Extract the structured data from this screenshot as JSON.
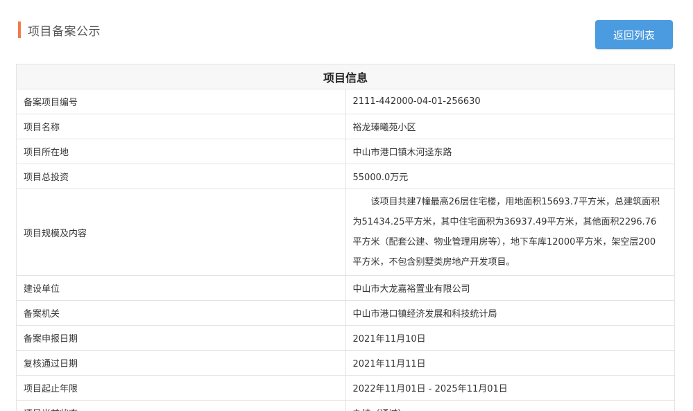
{
  "header": {
    "title": "项目备案公示",
    "accent_color": "#f37a4a"
  },
  "actions": {
    "back_label": "返回列表",
    "back_color": "#4a9be0"
  },
  "table": {
    "caption": "项目信息",
    "rows": [
      {
        "label": "备案项目编号",
        "value": "2111-442000-04-01-256630"
      },
      {
        "label": "项目名称",
        "value": "裕龙瑧曦苑小区"
      },
      {
        "label": "项目所在地",
        "value": "中山市港口镇木河迳东路"
      },
      {
        "label": "项目总投资",
        "value": "55000.0万元"
      },
      {
        "label": "项目规模及内容",
        "value": "该项目共建7幢最高26层住宅楼，用地面积15693.7平方米，总建筑面积为51434.25平方米，其中住宅面积为36937.49平方米，其他面积2296.76平方米（配套公建、物业管理用房等），地下车库12000平方米，架空层200平方米，不包含别墅类房地产开发项目。"
      },
      {
        "label": "建设单位",
        "value": "中山市大龙嘉裕置业有限公司"
      },
      {
        "label": "备案机关",
        "value": "中山市港口镇经济发展和科技统计局"
      },
      {
        "label": "备案申报日期",
        "value": "2021年11月10日"
      },
      {
        "label": "复核通过日期",
        "value": "2021年11月11日"
      },
      {
        "label": "项目起止年限",
        "value": "2022年11月01日 - 2025年11月01日"
      },
      {
        "label": "项目当前状态",
        "value": "办结（通过）"
      }
    ]
  }
}
